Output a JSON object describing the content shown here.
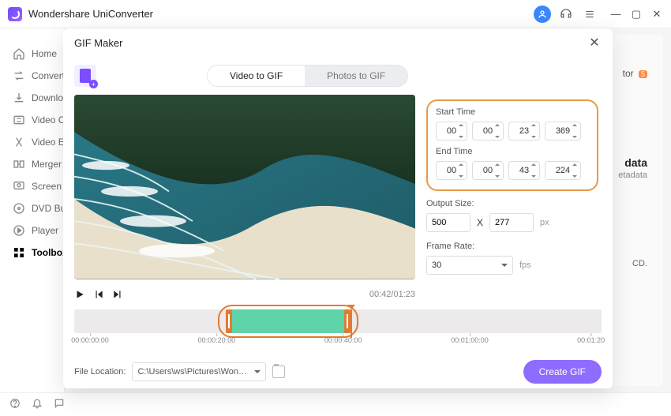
{
  "app": {
    "title": "Wondershare UniConverter"
  },
  "sidebar": {
    "items": [
      {
        "label": "Home"
      },
      {
        "label": "Converter"
      },
      {
        "label": "Downloader"
      },
      {
        "label": "Video Compressor"
      },
      {
        "label": "Video Editor"
      },
      {
        "label": "Merger"
      },
      {
        "label": "Screen Recorder"
      },
      {
        "label": "DVD Burner"
      },
      {
        "label": "Player"
      },
      {
        "label": "Toolbox"
      }
    ]
  },
  "bgpane": {
    "rtop": "tor",
    "badge": "5",
    "rmid": "data",
    "rmid2": "etadata",
    "rlow": "CD."
  },
  "modal": {
    "title": "GIF Maker",
    "tabs": {
      "video": "Video to GIF",
      "photos": "Photos to GIF"
    },
    "start_label": "Start Time",
    "end_label": "End Time",
    "start": {
      "h": "00",
      "m": "00",
      "s": "23",
      "ms": "369"
    },
    "end": {
      "h": "00",
      "m": "00",
      "s": "43",
      "ms": "224"
    },
    "output_label": "Output Size:",
    "out_w": "500",
    "out_x": "X",
    "out_h": "277",
    "out_unit": "px",
    "frame_label": "Frame Rate:",
    "frame_val": "30",
    "frame_unit": "fps",
    "timecode": "00:42/01:23",
    "timeline": {
      "ticks": [
        "00:00:00:00",
        "00:00:20:00",
        "00:00:40:00",
        "00:01:00:00",
        "00:01:20"
      ]
    },
    "file_label": "File Location:",
    "file_path": "C:\\Users\\ws\\Pictures\\Wonders",
    "create": "Create GIF"
  }
}
